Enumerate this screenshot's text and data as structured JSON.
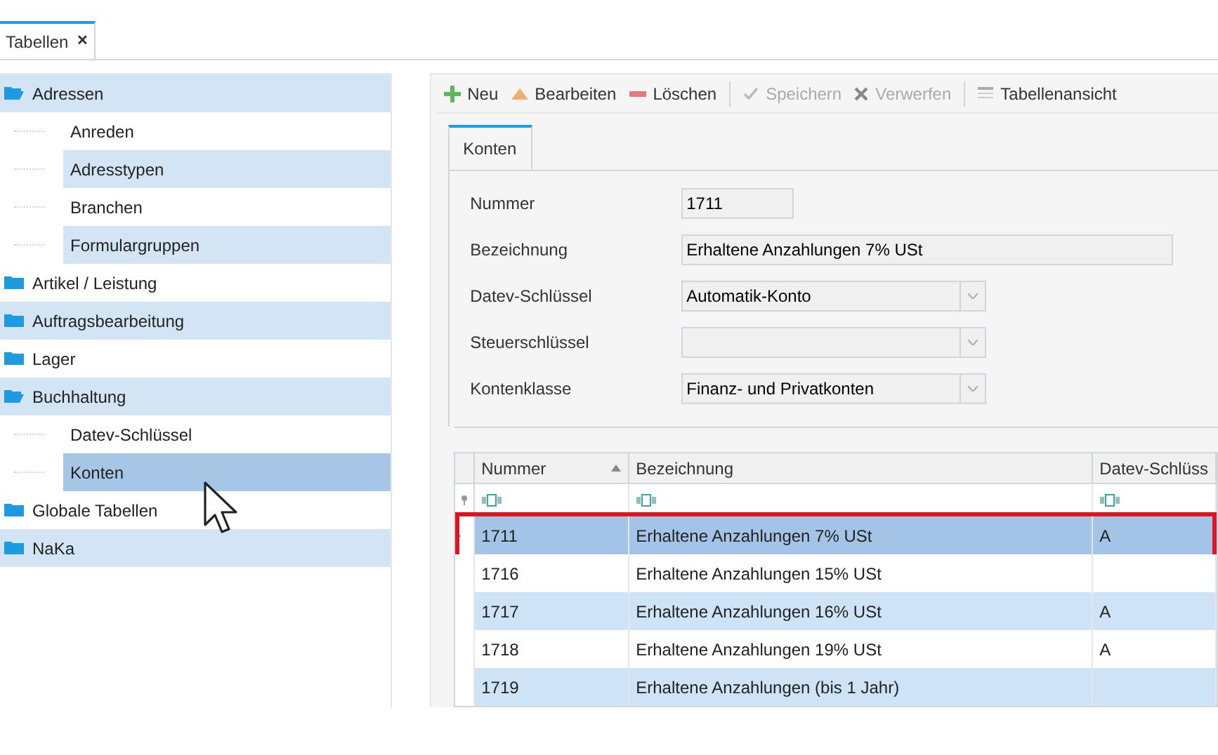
{
  "doc_tabs": [
    {
      "label": "Tabellen",
      "close": "✕",
      "selected": true
    }
  ],
  "tree": [
    {
      "label": "Adressen",
      "expanded": true,
      "selected": false,
      "children": [
        {
          "label": "Anreden",
          "selected": false
        },
        {
          "label": "Adresstypen",
          "selected": false
        },
        {
          "label": "Branchen",
          "selected": false
        },
        {
          "label": "Formulargruppen",
          "selected": false
        }
      ]
    },
    {
      "label": "Artikel / Leistung",
      "expanded": false,
      "selected": false
    },
    {
      "label": "Auftragsbearbeitung",
      "expanded": false,
      "selected": false
    },
    {
      "label": "Lager",
      "expanded": false,
      "selected": false
    },
    {
      "label": "Buchhaltung",
      "expanded": true,
      "selected": false,
      "children": [
        {
          "label": "Datev-Schlüssel",
          "selected": false
        },
        {
          "label": "Konten",
          "selected": true
        }
      ]
    },
    {
      "label": "Globale Tabellen",
      "expanded": false,
      "selected": false
    },
    {
      "label": "NaKa",
      "expanded": false,
      "selected": false
    }
  ],
  "toolbar": [
    {
      "kind": "add",
      "label": "Neu",
      "disabled": false
    },
    {
      "kind": "edit",
      "label": "Bearbeiten",
      "disabled": false
    },
    {
      "kind": "delete",
      "label": "Löschen",
      "disabled": false
    },
    {
      "kind": "separator"
    },
    {
      "kind": "save",
      "label": "Speichern",
      "disabled": true
    },
    {
      "kind": "discard",
      "label": "Verwerfen",
      "disabled": true
    },
    {
      "kind": "separator"
    },
    {
      "kind": "table",
      "label": "Tabellenansicht",
      "disabled": false
    }
  ],
  "form_tabs": [
    {
      "label": "Konten",
      "selected": true
    }
  ],
  "form": [
    {
      "kind": "short",
      "label": "Nummer",
      "value": "1711"
    },
    {
      "kind": "wide",
      "label": "Bezeichnung",
      "value": "Erhaltene Anzahlungen 7% USt"
    },
    {
      "kind": "select",
      "label": "Datev-Schlüssel",
      "value": "Automatik-Konto"
    },
    {
      "kind": "select",
      "label": "Steuerschlüssel"
    },
    {
      "kind": "select",
      "label": "Kontenklasse",
      "value": "Finanz- und Privatkonten"
    }
  ],
  "table": {
    "columns": [
      {
        "label": "Nummer",
        "sorted": true
      },
      {
        "label": "Bezeichnung",
        "sorted": false
      },
      {
        "label": "Datev-Schlüss",
        "sorted": false
      }
    ],
    "rows": [
      {
        "selected": true,
        "cells": [
          "1711",
          "Erhaltene Anzahlungen 7% USt",
          "A"
        ]
      },
      {
        "selected": false,
        "cells": [
          "1716",
          "Erhaltene Anzahlungen 15% USt",
          ""
        ]
      },
      {
        "selected": false,
        "cells": [
          "1717",
          "Erhaltene Anzahlungen 16% USt",
          "A"
        ]
      },
      {
        "selected": false,
        "cells": [
          "1718",
          "Erhaltene Anzahlungen 19% USt",
          "A"
        ]
      },
      {
        "selected": false,
        "cells": [
          "1719",
          "Erhaltene Anzahlungen (bis 1 Jahr)",
          ""
        ]
      }
    ]
  }
}
